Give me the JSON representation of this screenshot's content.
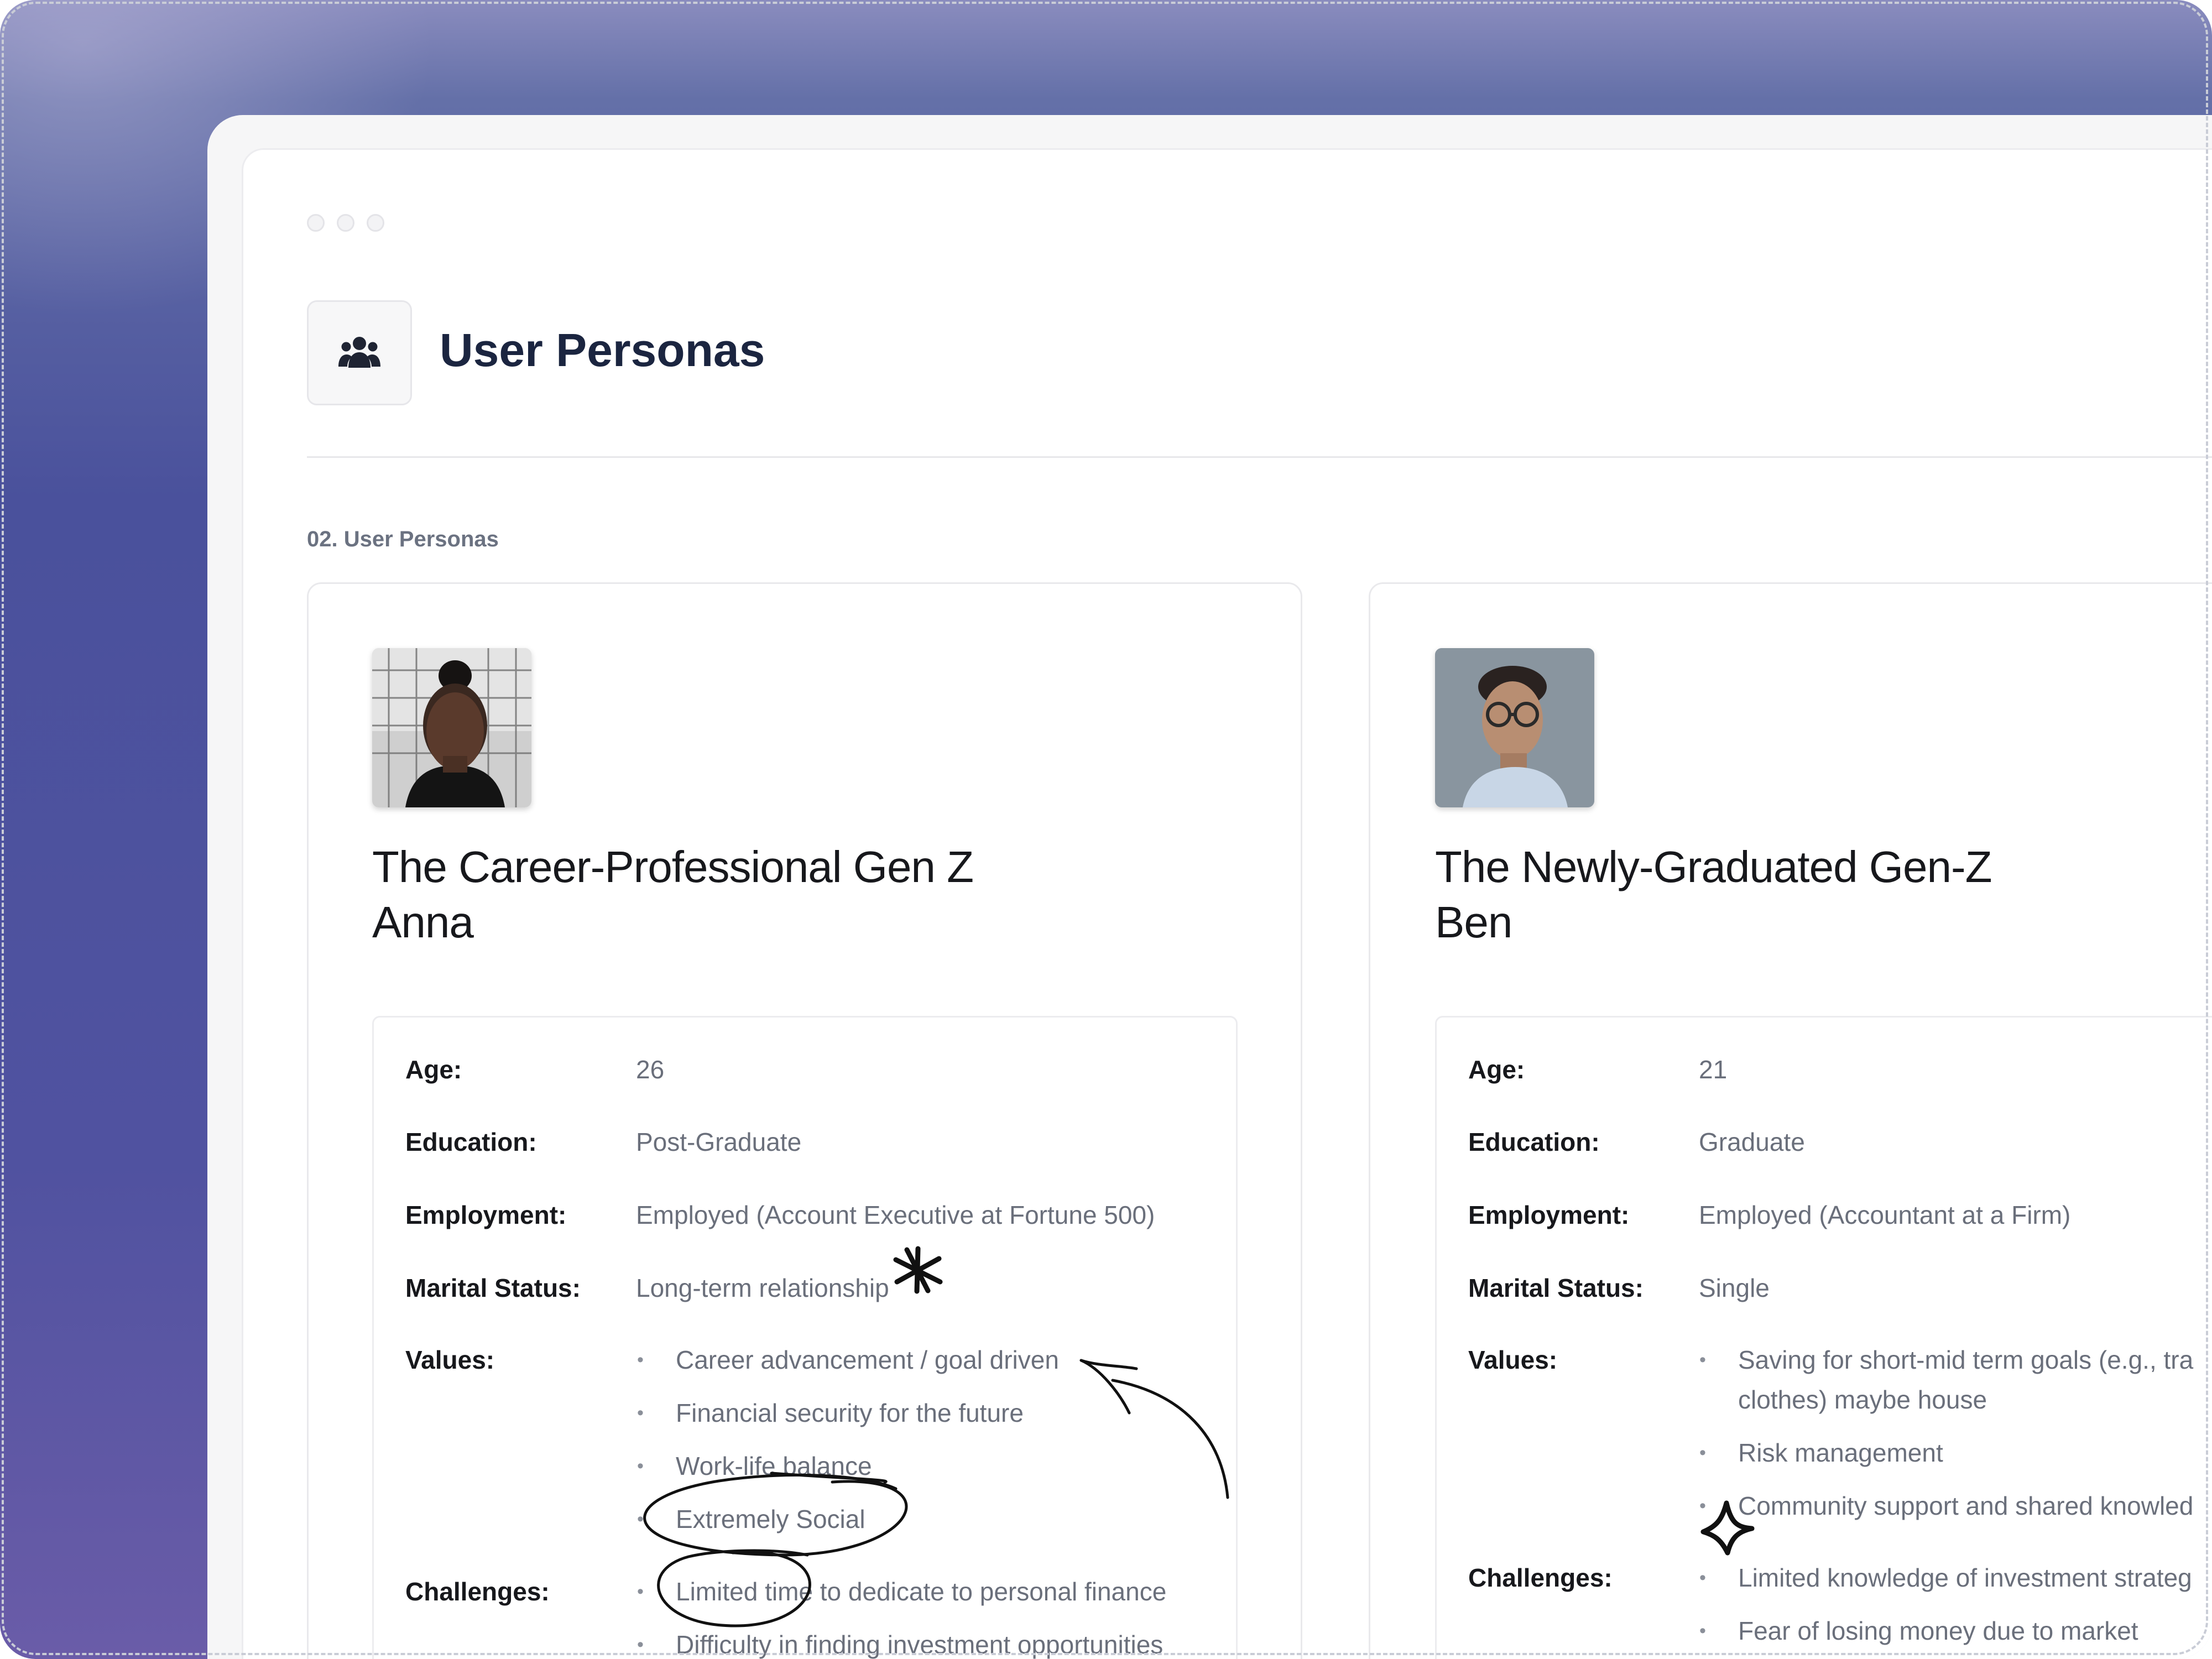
{
  "page": {
    "title": "User Personas",
    "section_label": "02. User Personas"
  },
  "icons": {
    "header": "users-group-icon",
    "window_controls": [
      "window-dot-icon",
      "window-dot-icon",
      "window-dot-icon"
    ]
  },
  "personas": [
    {
      "title": "The Career-Professional Gen Z",
      "name": "Anna",
      "age_label": "Age:",
      "age": "26",
      "education_label": "Education:",
      "education": "Post-Graduate",
      "employment_label": "Employment:",
      "employment": "Employed (Account Executive at Fortune 500)",
      "marital_label": "Marital Status:",
      "marital": "Long-term relationship",
      "values_label": "Values:",
      "values": [
        "Career advancement / goal driven",
        "Financial security for the future",
        "Work-life balance",
        "Extremely Social"
      ],
      "challenges_label": "Challenges:",
      "challenges": [
        "Limited time to dedicate to personal finance",
        "Difficulty in finding investment opportunities"
      ]
    },
    {
      "title": "The Newly-Graduated Gen-Z",
      "name": "Ben",
      "age_label": "Age:",
      "age": "21",
      "education_label": "Education:",
      "education": "Graduate",
      "employment_label": "Employment:",
      "employment": "Employed (Accountant at a Firm)",
      "marital_label": "Marital Status:",
      "marital": "Single",
      "values_label": "Values:",
      "values": [
        "Saving for short-mid term goals (e.g., tra",
        "clothes) maybe house",
        "Risk management",
        "Community support and shared knowled"
      ],
      "challenges_label": "Challenges:",
      "challenges": [
        "Limited knowledge of investment strateg",
        "Fear of losing money due to market"
      ]
    }
  ],
  "annotations": {
    "colors": {
      "ink": "#111111"
    },
    "marks": [
      "asterisk-doodle-icon",
      "arrow-doodle-icon",
      "underline-doodle",
      "circle-doodle",
      "circle-doodle",
      "sparkle-doodle-icon"
    ]
  }
}
